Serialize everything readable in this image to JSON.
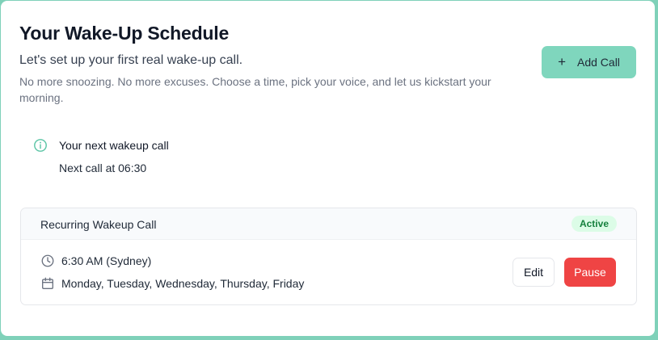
{
  "header": {
    "title": "Your Wake-Up Schedule",
    "subtitle": "Let's set up your first real wake-up call.",
    "description": "No more snoozing. No more excuses. Choose a time, pick your voice, and let us kickstart your morning.",
    "add_button": {
      "icon": "plus-icon",
      "label": "Add Call"
    }
  },
  "next_call": {
    "icon": "info-icon",
    "title": "Your next wakeup call",
    "text": "Next call at 06:30"
  },
  "schedule": {
    "title": "Recurring Wakeup Call",
    "status": "Active",
    "time": {
      "icon": "clock-icon",
      "text": "6:30 AM (Sydney)"
    },
    "days": {
      "icon": "calendar-icon",
      "text": "Monday, Tuesday, Wednesday, Thursday, Friday"
    },
    "edit_label": "Edit",
    "pause_label": "Pause"
  },
  "colors": {
    "accent": "#7fd6bd",
    "danger": "#ef4444",
    "badge_bg": "#dcfce7",
    "badge_text": "#15803d"
  }
}
